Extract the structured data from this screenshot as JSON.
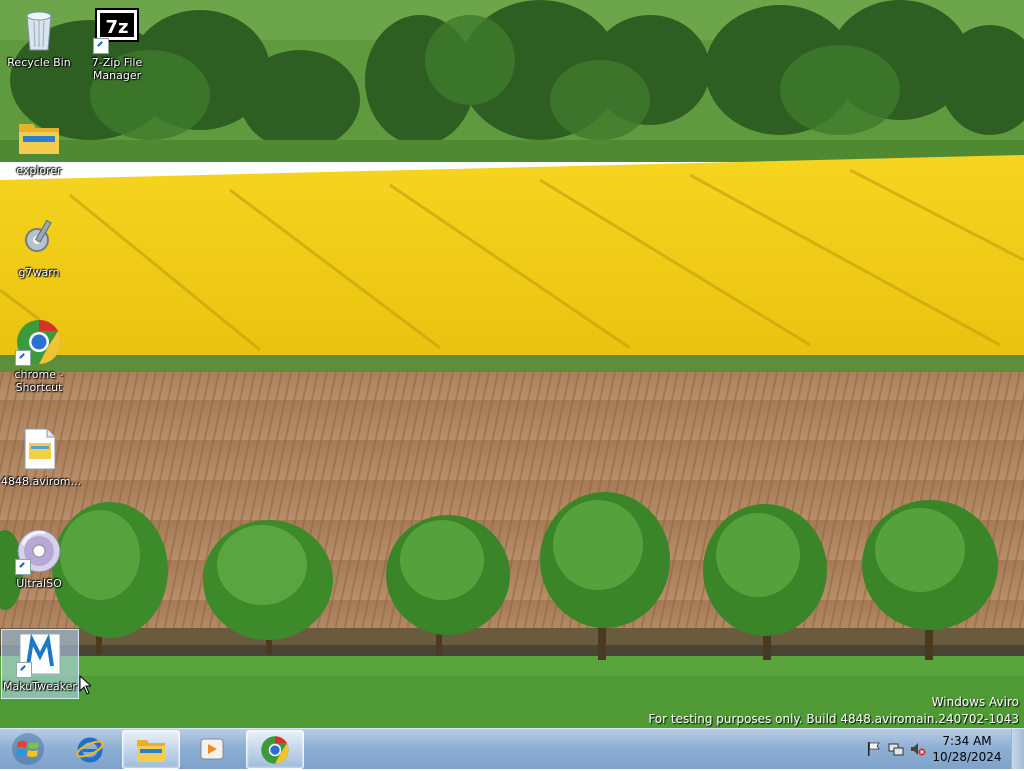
{
  "desktop": {
    "icons": [
      {
        "label": "Recycle Bin"
      },
      {
        "label": "7-Zip File\nManager"
      },
      {
        "label": "explorer"
      },
      {
        "label": "g7warn"
      },
      {
        "label": "chrome -\nShortcut"
      },
      {
        "label": "4848.avirom..."
      },
      {
        "label": "UltraISO"
      },
      {
        "label": "MakuTweaker"
      }
    ]
  },
  "watermark": {
    "line1": "Windows Aviro",
    "line2": "For testing purposes only. Build 4848.aviromain.240702-1043"
  },
  "taskbar": {
    "start_icon": "windows-orb-icon",
    "pinned": [
      {
        "name": "internet-explorer",
        "icon": "ie-icon"
      },
      {
        "name": "file-explorer",
        "icon": "folder-icon"
      },
      {
        "name": "media-player",
        "icon": "media-player-icon"
      },
      {
        "name": "chrome",
        "icon": "chrome-icon"
      }
    ],
    "tray_icons": [
      "flag-icon",
      "network-icon",
      "volume-muted-icon"
    ],
    "clock": {
      "time": "7:34 AM",
      "date": "10/28/2024"
    }
  },
  "colors": {
    "taskbar": "#8fb0d4",
    "rapeseed": "#f2cf18",
    "soil": "#b08660",
    "grass": "#4f9a34"
  }
}
